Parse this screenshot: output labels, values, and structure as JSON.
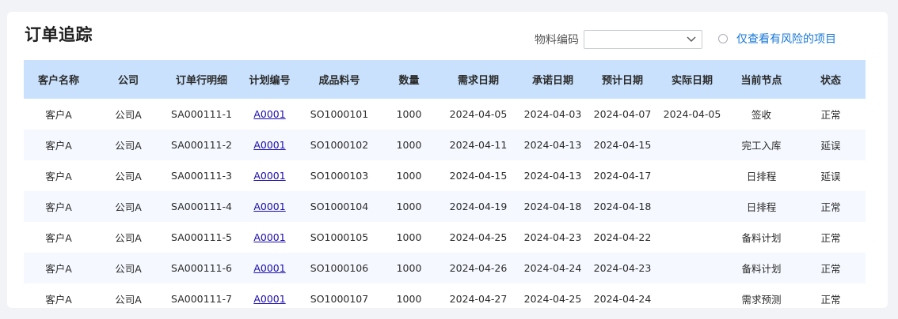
{
  "title": "订单追踪",
  "filter": {
    "material_code_label": "物料编码",
    "material_code_value": "",
    "risk_only_label": "仅查看有风险的项目",
    "risk_only_checked": false
  },
  "table": {
    "columns": [
      "客户名称",
      "公司",
      "订单行明细",
      "计划编号",
      "成品料号",
      "数量",
      "需求日期",
      "承诺日期",
      "预计日期",
      "实际日期",
      "当前节点",
      "状态"
    ],
    "rows": [
      {
        "customer": "客户A",
        "company": "公司A",
        "order_line": "SA000111-1",
        "plan_no": "A0001",
        "product_no": "SO1000101",
        "qty": "1000",
        "demand_date": "2024-04-05",
        "promise_date": "2024-04-03",
        "est_date": "2024-04-07",
        "actual_date": "2024-04-05",
        "node": "签收",
        "status": "正常"
      },
      {
        "customer": "客户A",
        "company": "公司A",
        "order_line": "SA000111-2",
        "plan_no": "A0001",
        "product_no": "SO1000102",
        "qty": "1000",
        "demand_date": "2024-04-11",
        "promise_date": "2024-04-13",
        "est_date": "2024-04-15",
        "actual_date": "",
        "node": "完工入库",
        "status": "延误"
      },
      {
        "customer": "客户A",
        "company": "公司A",
        "order_line": "SA000111-3",
        "plan_no": "A0001",
        "product_no": "SO1000103",
        "qty": "1000",
        "demand_date": "2024-04-15",
        "promise_date": "2024-04-13",
        "est_date": "2024-04-17",
        "actual_date": "",
        "node": "日排程",
        "status": "延误"
      },
      {
        "customer": "客户A",
        "company": "公司A",
        "order_line": "SA000111-4",
        "plan_no": "A0001",
        "product_no": "SO1000104",
        "qty": "1000",
        "demand_date": "2024-04-19",
        "promise_date": "2024-04-18",
        "est_date": "2024-04-18",
        "actual_date": "",
        "node": "日排程",
        "status": "正常"
      },
      {
        "customer": "客户A",
        "company": "公司A",
        "order_line": "SA000111-5",
        "plan_no": "A0001",
        "product_no": "SO1000105",
        "qty": "1000",
        "demand_date": "2024-04-25",
        "promise_date": "2024-04-23",
        "est_date": "2024-04-22",
        "actual_date": "",
        "node": "备料计划",
        "status": "正常"
      },
      {
        "customer": "客户A",
        "company": "公司A",
        "order_line": "SA000111-6",
        "plan_no": "A0001",
        "product_no": "SO1000106",
        "qty": "1000",
        "demand_date": "2024-04-26",
        "promise_date": "2024-04-24",
        "est_date": "2024-04-23",
        "actual_date": "",
        "node": "备料计划",
        "status": "正常"
      },
      {
        "customer": "客户A",
        "company": "公司A",
        "order_line": "SA000111-7",
        "plan_no": "A0001",
        "product_no": "SO1000107",
        "qty": "1000",
        "demand_date": "2024-04-27",
        "promise_date": "2024-04-25",
        "est_date": "2024-04-24",
        "actual_date": "",
        "node": "需求预测",
        "status": "正常"
      }
    ]
  },
  "icons": {
    "select_arrow": "chevron-down-icon",
    "risk_radio": "radio-icon"
  },
  "colors": {
    "header_bg": "#c9e1fc",
    "link": "#1a0dab",
    "accent": "#1677d8"
  }
}
